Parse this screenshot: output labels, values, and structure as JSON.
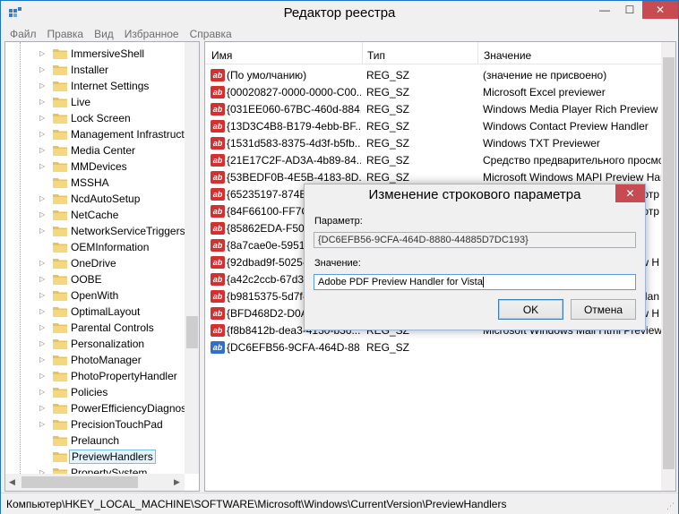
{
  "window": {
    "title": "Редактор реестра",
    "min": "—",
    "max": "☐",
    "close": "✕"
  },
  "menu": [
    "Файл",
    "Правка",
    "Вид",
    "Избранное",
    "Справка"
  ],
  "tree": {
    "items": [
      {
        "label": "ImmersiveShell",
        "expandable": true
      },
      {
        "label": "Installer",
        "expandable": true
      },
      {
        "label": "Internet Settings",
        "expandable": true
      },
      {
        "label": "Live",
        "expandable": true
      },
      {
        "label": "Lock Screen",
        "expandable": true
      },
      {
        "label": "Management Infrastruct",
        "expandable": true
      },
      {
        "label": "Media Center",
        "expandable": true
      },
      {
        "label": "MMDevices",
        "expandable": true
      },
      {
        "label": "MSSHA",
        "expandable": false
      },
      {
        "label": "NcdAutoSetup",
        "expandable": true
      },
      {
        "label": "NetCache",
        "expandable": true
      },
      {
        "label": "NetworkServiceTriggers",
        "expandable": true
      },
      {
        "label": "OEMInformation",
        "expandable": false
      },
      {
        "label": "OneDrive",
        "expandable": true
      },
      {
        "label": "OOBE",
        "expandable": true
      },
      {
        "label": "OpenWith",
        "expandable": true
      },
      {
        "label": "OptimalLayout",
        "expandable": true
      },
      {
        "label": "Parental Controls",
        "expandable": true
      },
      {
        "label": "Personalization",
        "expandable": true
      },
      {
        "label": "PhotoManager",
        "expandable": true
      },
      {
        "label": "PhotoPropertyHandler",
        "expandable": true
      },
      {
        "label": "Policies",
        "expandable": true
      },
      {
        "label": "PowerEfficiencyDiagnos",
        "expandable": true
      },
      {
        "label": "PrecisionTouchPad",
        "expandable": true
      },
      {
        "label": "Prelaunch",
        "expandable": false
      },
      {
        "label": "PreviewHandlers",
        "expandable": false,
        "selected": true
      },
      {
        "label": "PropertySystem",
        "expandable": true
      }
    ]
  },
  "values": {
    "headers": {
      "name": "Имя",
      "type": "Тип",
      "value": "Значение"
    },
    "rows": [
      {
        "name": "(По умолчанию)",
        "type": "REG_SZ",
        "value": "(значение не присвоено)"
      },
      {
        "name": "{00020827-0000-0000-C00...",
        "type": "REG_SZ",
        "value": "Microsoft Excel previewer"
      },
      {
        "name": "{031EE060-67BC-460d-884...",
        "type": "REG_SZ",
        "value": "Windows Media Player Rich Preview Han"
      },
      {
        "name": "{13D3C4B8-B179-4ebb-BF...",
        "type": "REG_SZ",
        "value": "Windows Contact Preview Handler"
      },
      {
        "name": "{1531d583-8375-4d3f-b5fb...",
        "type": "REG_SZ",
        "value": "Windows TXT Previewer"
      },
      {
        "name": "{21E17C2F-AD3A-4b89-84...",
        "type": "REG_SZ",
        "value": "Средство предварительного просмотр"
      },
      {
        "name": "{53BEDF0B-4E5B-4183-8D...",
        "type": "REG_SZ",
        "value": "Microsoft Windows MAPI Preview Handl"
      },
      {
        "name": "{65235197-874B-",
        "type": "",
        "value": "просмотр"
      },
      {
        "name": "{84F66100-FF7C-",
        "type": "",
        "value": "просмотр"
      },
      {
        "name": "{85862EDA-F507",
        "type": "",
        "value": ""
      },
      {
        "name": "{8a7cae0e-5951-",
        "type": "",
        "value": ""
      },
      {
        "name": "{92dbad9f-5025-",
        "type": "",
        "value": "eview H"
      },
      {
        "name": "{a42c2ccb-67d3-",
        "type": "",
        "value": ""
      },
      {
        "name": "{b9815375-5d7f-",
        "type": "",
        "value": "ew Han"
      },
      {
        "name": "{BFD468D2-D0A0",
        "type": "",
        "value": "eview H"
      },
      {
        "name": "{f8b8412b-dea3-4130-b36...",
        "type": "REG_SZ",
        "value": "Microsoft Windows Mail Html Preview H"
      },
      {
        "name": "{DC6EFB56-9CFA-464D-88...",
        "type": "REG_SZ",
        "value": "",
        "blue": true
      }
    ]
  },
  "status": "Компьютер\\HKEY_LOCAL_MACHINE\\SOFTWARE\\Microsoft\\Windows\\CurrentVersion\\PreviewHandlers",
  "dialog": {
    "title": "Изменение строкового параметра",
    "close": "✕",
    "param_label": "Параметр:",
    "param_value": "{DC6EFB56-9CFA-464D-8880-44885D7DC193}",
    "value_label": "Значение:",
    "value_text": "Adobe PDF Preview Handler for Vista",
    "ok": "OK",
    "cancel": "Отмена"
  },
  "colors": {
    "close_red": "#c74b50",
    "selection_bg": "#e5f3fb",
    "selection_border": "#70c0e7",
    "string_icon": "#d43030",
    "folder": "#e8c35a"
  }
}
